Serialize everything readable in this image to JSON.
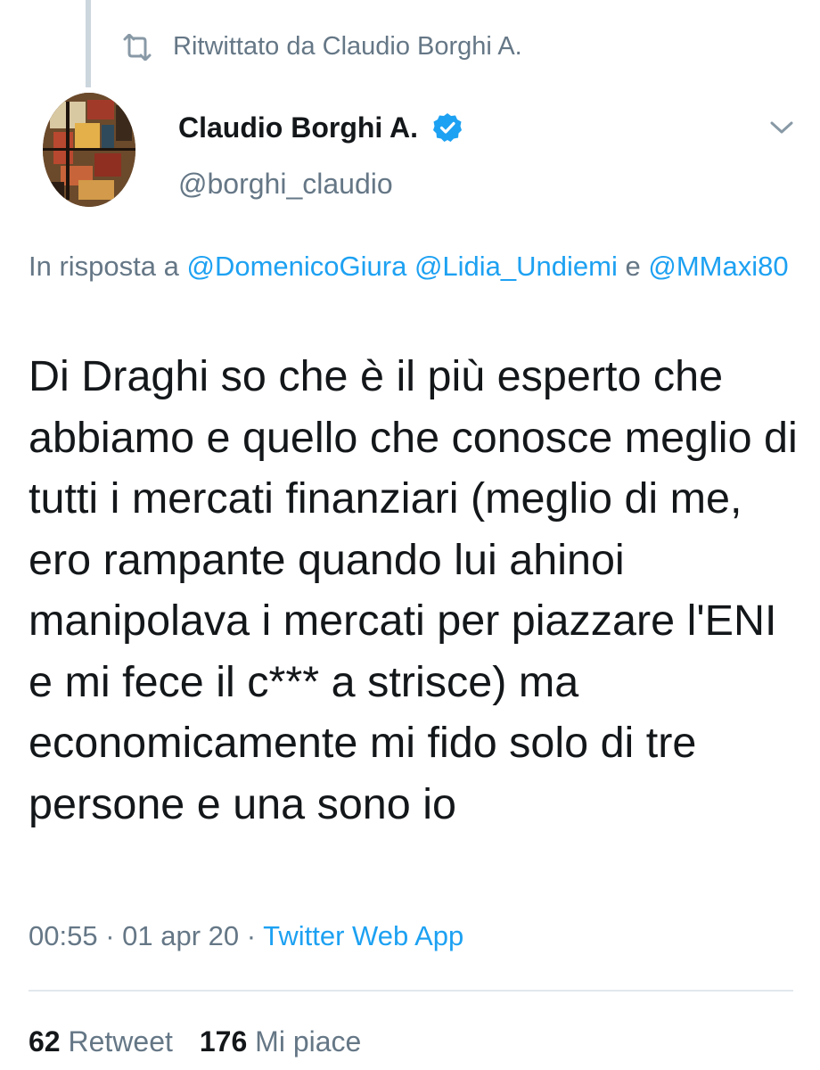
{
  "retweet_context": {
    "label": "Ritwittato da Claudio Borghi A.",
    "icon": "retweet-icon"
  },
  "author": {
    "name": "Claudio Borghi A.",
    "handle": "@borghi_claudio",
    "verified": true,
    "verified_icon": "verified-badge-icon",
    "avatar_icon": "abstract-painting-avatar"
  },
  "reply": {
    "prefix": "In risposta a ",
    "mention_1": "@DomenicoGiura",
    "mention_2": "@Lidia_Undiemi",
    "conjunction": " e ",
    "mention_3": "@MMaxi80"
  },
  "tweet": {
    "text": "Di Draghi so che è il più esperto che abbiamo e quello che conosce meglio di tutti i mercati finanziari (meglio di me, ero rampante quando lui ahinoi manipolava i mercati per piazzare l'ENI e mi fece il c*** a strisce) ma economicamente mi fido solo di tre persone e una sono io"
  },
  "meta": {
    "time": "00:55",
    "separator": " · ",
    "date": "01 apr 20",
    "source": "Twitter Web App"
  },
  "stats": {
    "retweets_count": "62",
    "retweets_label": "Retweet",
    "likes_count": "176",
    "likes_label": "Mi piace"
  },
  "colors": {
    "accent": "#1da1f2",
    "secondary_text": "#657786",
    "primary_text": "#14171a",
    "thread_line": "#ccd6dd"
  }
}
